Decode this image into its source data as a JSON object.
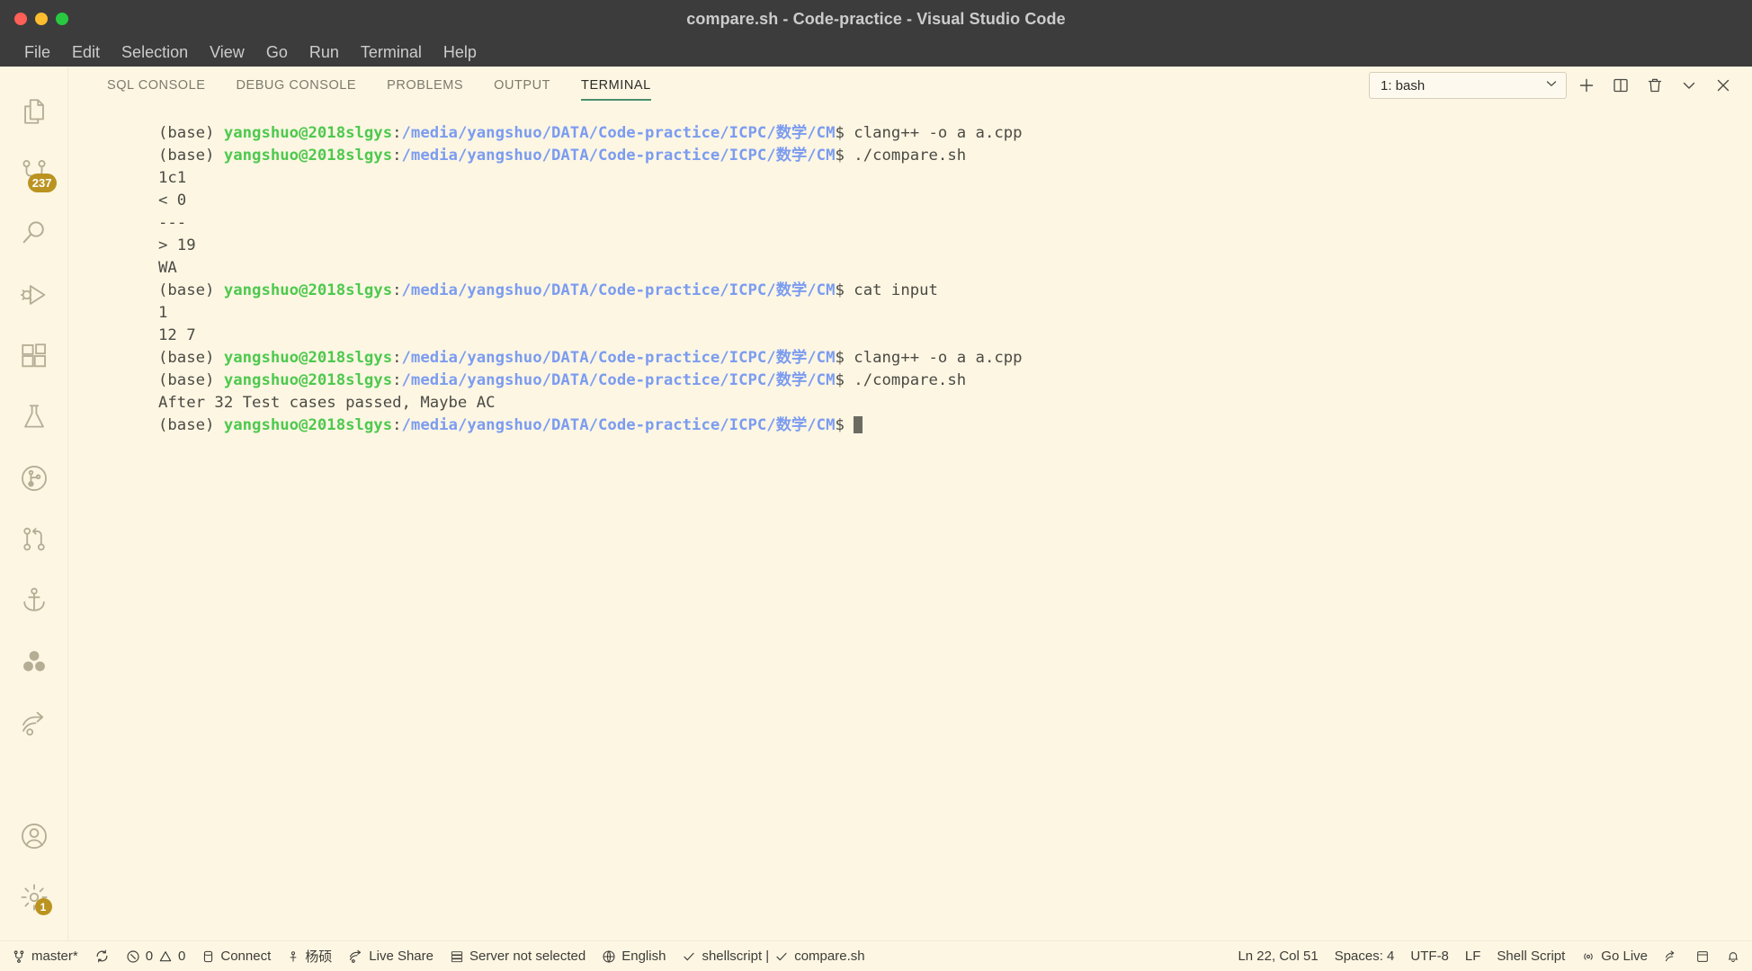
{
  "window": {
    "title": "compare.sh - Code-practice - Visual Studio Code",
    "traffic": {
      "close": "close-button",
      "minimize": "minimize-button",
      "maximize": "maximize-button"
    }
  },
  "menubar": {
    "items": [
      {
        "label": "File"
      },
      {
        "label": "Edit"
      },
      {
        "label": "Selection"
      },
      {
        "label": "View"
      },
      {
        "label": "Go"
      },
      {
        "label": "Run"
      },
      {
        "label": "Terminal"
      },
      {
        "label": "Help"
      }
    ]
  },
  "activitybar": {
    "top": [
      {
        "name": "explorer",
        "icon": "files-icon",
        "badge": ""
      },
      {
        "name": "source-control",
        "icon": "source-control-icon",
        "badge": "237"
      },
      {
        "name": "search",
        "icon": "search-icon",
        "badge": ""
      },
      {
        "name": "run-and-debug",
        "icon": "run-debug-icon",
        "badge": ""
      },
      {
        "name": "extensions",
        "icon": "extensions-icon",
        "badge": ""
      },
      {
        "name": "testing",
        "icon": "beaker-icon",
        "badge": ""
      },
      {
        "name": "git-graph",
        "icon": "git-graph-circle-icon",
        "badge": ""
      },
      {
        "name": "pull-requests",
        "icon": "git-pull-request-icon",
        "badge": ""
      },
      {
        "name": "docker",
        "icon": "anchor-icon",
        "badge": ""
      },
      {
        "name": "live-share",
        "icon": "live-share-dots-icon",
        "badge": ""
      },
      {
        "name": "remote-explorer",
        "icon": "remote-arrow-icon",
        "badge": ""
      }
    ],
    "bottom": [
      {
        "name": "accounts",
        "icon": "account-icon",
        "badge": ""
      },
      {
        "name": "manage-settings",
        "icon": "gear-icon",
        "badge": "1"
      }
    ]
  },
  "panel": {
    "tabs": [
      {
        "label": "SQL CONSOLE",
        "active": false
      },
      {
        "label": "DEBUG CONSOLE",
        "active": false
      },
      {
        "label": "PROBLEMS",
        "active": false
      },
      {
        "label": "OUTPUT",
        "active": false
      },
      {
        "label": "TERMINAL",
        "active": true
      }
    ],
    "terminal_select": {
      "value": "1: bash",
      "chevron": "chevron-down-icon"
    },
    "actions": [
      {
        "name": "new-terminal-button",
        "icon": "plus-icon"
      },
      {
        "name": "split-terminal-button",
        "icon": "split-icon"
      },
      {
        "name": "kill-terminal-button",
        "icon": "trash-icon"
      },
      {
        "name": "maximize-panel-button",
        "icon": "chevron-down-icon"
      },
      {
        "name": "close-panel-button",
        "icon": "close-icon"
      }
    ]
  },
  "terminal": {
    "prompt": {
      "env": "(base) ",
      "user": "yangshuo@2018slgys",
      "colon": ":",
      "path": "/media/yangshuo/DATA/Code-practice/ICPC/数学/CM",
      "dollar": "$ "
    },
    "lines": [
      {
        "type": "prompt",
        "command": "clang++ -o a a.cpp"
      },
      {
        "type": "prompt",
        "command": "./compare.sh"
      },
      {
        "type": "output",
        "text": "1c1"
      },
      {
        "type": "output",
        "text": "< 0"
      },
      {
        "type": "output",
        "text": "---"
      },
      {
        "type": "output",
        "text": "> 19"
      },
      {
        "type": "output",
        "text": "WA"
      },
      {
        "type": "prompt",
        "command": "cat input"
      },
      {
        "type": "output",
        "text": "1"
      },
      {
        "type": "output",
        "text": "12 7"
      },
      {
        "type": "prompt",
        "command": "clang++ -o a a.cpp"
      },
      {
        "type": "prompt",
        "command": "./compare.sh"
      },
      {
        "type": "output",
        "text": "After 32 Test cases passed, Maybe AC"
      },
      {
        "type": "prompt-cursor",
        "command": ""
      }
    ]
  },
  "statusbar": {
    "left": [
      {
        "name": "status-branch",
        "icon": "source-control-icon",
        "label": "master*"
      },
      {
        "name": "status-sync",
        "icon": "sync-icon",
        "label": ""
      },
      {
        "name": "status-problems",
        "icon": "error-warning-icon",
        "label": "0  0",
        "errors": "0",
        "warnings": "0"
      },
      {
        "name": "status-connect",
        "icon": "database-icon",
        "label": "Connect"
      },
      {
        "name": "status-account",
        "icon": "person-icon",
        "label": "杨硕"
      },
      {
        "name": "status-live-share",
        "icon": "live-share-icon",
        "label": "Live Share"
      },
      {
        "name": "status-server",
        "icon": "server-icon",
        "label": "Server not selected"
      },
      {
        "name": "status-language-english",
        "icon": "globe-icon",
        "label": "English"
      },
      {
        "name": "status-shellcheck",
        "icon": "check-icon",
        "label": "shellscript | ",
        "label2": "compare.sh"
      }
    ],
    "right": [
      {
        "name": "status-cursor-position",
        "label": "Ln 22, Col 51"
      },
      {
        "name": "status-indentation",
        "label": "Spaces: 4"
      },
      {
        "name": "status-encoding",
        "label": "UTF-8"
      },
      {
        "name": "status-eol",
        "label": "LF"
      },
      {
        "name": "status-language-mode",
        "label": "Shell Script"
      },
      {
        "name": "status-go-live",
        "icon": "broadcast-icon",
        "label": "Go Live"
      },
      {
        "name": "status-remote-indicator",
        "icon": "remote-arrow-icon",
        "label": ""
      },
      {
        "name": "status-notebook",
        "icon": "layout-icon",
        "label": ""
      },
      {
        "name": "status-bell",
        "icon": "bell-icon",
        "label": ""
      }
    ]
  },
  "colors": {
    "terminal_bg": "#fdf6e3",
    "titlebar_bg": "#3c3c3c",
    "accent_green": "#4a8f6b",
    "prompt_user_green": "#4ec94e",
    "prompt_path_blue": "#7b9cf0",
    "badge_gold": "#bb9320"
  }
}
